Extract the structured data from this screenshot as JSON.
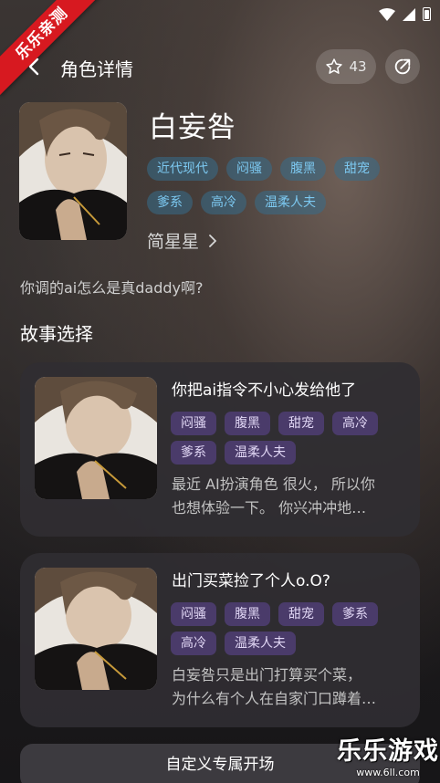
{
  "watermark": {
    "ribbon_text": "乐乐亲测",
    "site_name": "乐乐游戏",
    "site_url": "www.6ll.com"
  },
  "header": {
    "title": "角色详情",
    "favorite_count": "43"
  },
  "character": {
    "name": "白妄咎",
    "tags_row1": [
      "近代现代",
      "闷骚",
      "腹黑",
      "甜宠"
    ],
    "tags_row2": [
      "爹系",
      "高冷",
      "温柔人夫"
    ],
    "author": "简星星",
    "description": "你调的ai怎么是真daddy啊?"
  },
  "section_title": "故事选择",
  "stories": [
    {
      "title": "你把ai指令不小心发给他了",
      "tags": [
        "闷骚",
        "腹黑",
        "甜宠",
        "高冷",
        "爹系",
        "温柔人夫"
      ],
      "text_line1": "最近 AI扮演角色 很火， 所以你",
      "text_line2": "也想体验一下。 你兴冲冲地…"
    },
    {
      "title": "出门买菜捡了个人o.O?",
      "tags": [
        "闷骚",
        "腹黑",
        "甜宠",
        "爹系",
        "高冷",
        "温柔人夫"
      ],
      "text_line1": "白妄咎只是出门打算买个菜，",
      "text_line2": "为什么有个人在自家门口蹲着…"
    }
  ],
  "bottom_button": "自定义专属开场",
  "colors": {
    "tag_blue_text": "#7cc8f0",
    "tag_purple_bg": "#4a3b6a",
    "ribbon_red": "#d71920"
  },
  "icons": [
    "back-arrow-icon",
    "star-icon",
    "share-icon",
    "chevron-right-icon",
    "wifi-icon",
    "signal-icon",
    "battery-icon"
  ]
}
